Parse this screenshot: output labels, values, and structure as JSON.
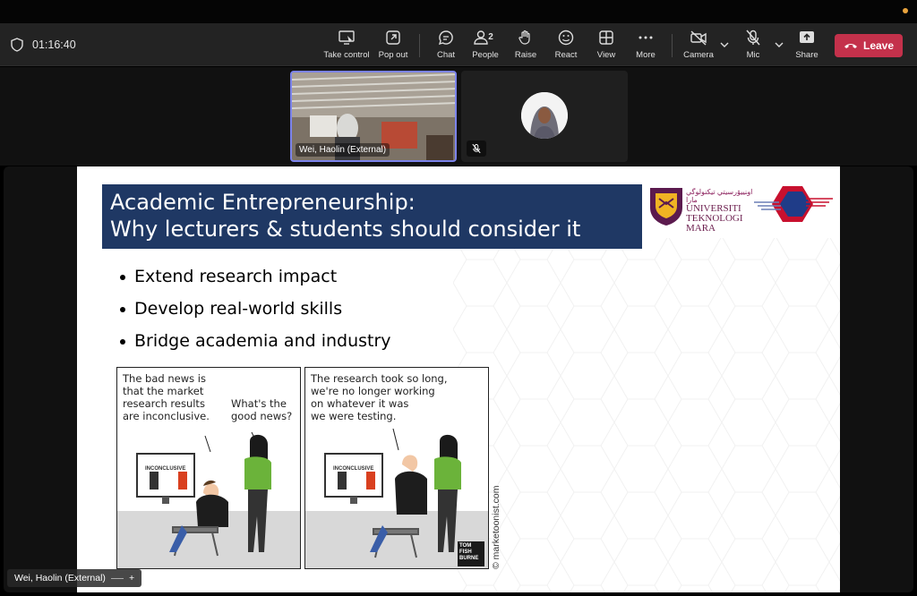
{
  "meeting": {
    "elapsed": "01:16:40",
    "people_count": "2"
  },
  "toolbar": {
    "take_control": "Take control",
    "pop_out": "Pop out",
    "chat": "Chat",
    "people": "People",
    "raise": "Raise",
    "react": "React",
    "view": "View",
    "more": "More",
    "camera": "Camera",
    "mic": "Mic",
    "share": "Share",
    "leave": "Leave"
  },
  "icons": {
    "shield": "shield-icon",
    "take_control": "take-control-icon",
    "pop_out": "pop-out-icon",
    "chat": "chat-icon",
    "people": "people-icon",
    "raise": "raise-hand-icon",
    "react": "react-icon",
    "view": "view-grid-icon",
    "more": "more-icon",
    "camera": "camera-off-icon",
    "mic": "mic-off-icon",
    "share": "share-icon",
    "leave": "phone-hangup-icon"
  },
  "colors": {
    "leave": "#c4314b",
    "active_speaker": "#7b83eb",
    "slide_title_bg": "#1f3864"
  },
  "participants": [
    {
      "name": "Wei, Haolin (External)",
      "video": true,
      "active": true
    },
    {
      "name": "",
      "video": false,
      "muted": true
    }
  ],
  "slide": {
    "title_line1": "Academic Entrepreneurship:",
    "title_line2": "Why lecturers & students should consider it",
    "logo_text_arabic": "ﺍﻭﻨﻴﯿﯚﺭﺳﻴﺘﻲ ﺗﻴﻜﻨﻮﻟﻮﮔﻲ ﻣﺎرا",
    "logo_text": [
      "UNIVERSITI",
      "TEKNOLOGI",
      "MARA"
    ],
    "bullets": [
      "Extend research impact",
      "Develop real-world skills",
      "Bridge academia and industry"
    ],
    "comic": {
      "panel1_caption": [
        "The bad news is",
        "that the market",
        "research results",
        "are inconclusive."
      ],
      "panel1_reply": [
        "What's the",
        "good news?"
      ],
      "panel2_caption": [
        "The research took so long,",
        "we're no longer working",
        "on whatever it was",
        "we were testing."
      ],
      "screen_label": "INCONCLUSIVE",
      "credit": "© marketoonist.com",
      "signature": [
        "TOM",
        "FISH",
        "BURNE"
      ]
    }
  },
  "presenter_chip": {
    "name": "Wei, Haolin (External)",
    "plus": "+"
  }
}
